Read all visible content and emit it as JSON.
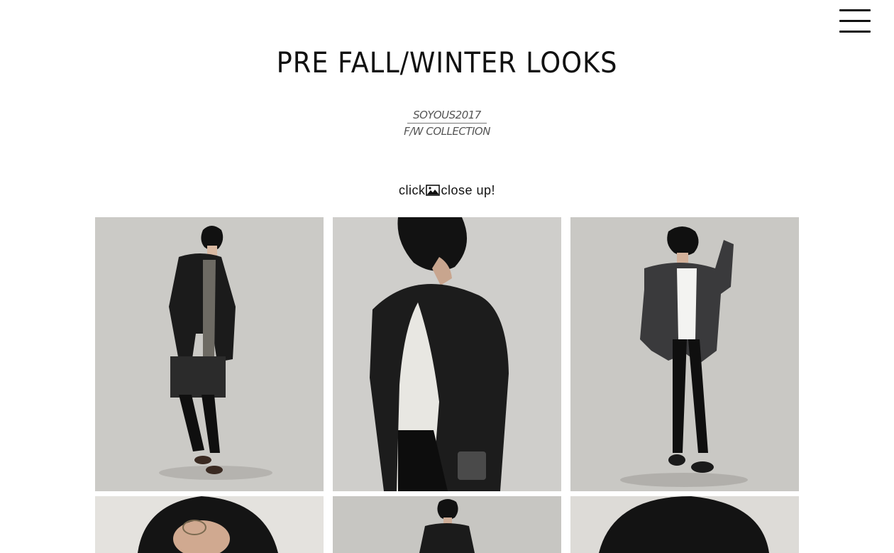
{
  "header": {
    "menu_icon": "hamburger-menu-icon",
    "title": "PRE FALL/WINTER LOOKS",
    "collection_line1": "SOYOUS2017",
    "collection_line2": "F/W COLLECTION"
  },
  "hint": {
    "before": "click",
    "icon": "picture-icon",
    "after": "close up!"
  },
  "gallery": {
    "background_color": "#c9c8c4",
    "looks": [
      {
        "name": "look-1",
        "description": "full-body, black jacket with clutch"
      },
      {
        "name": "look-2",
        "description": "close-up, black jacket over white tee"
      },
      {
        "name": "look-3",
        "description": "full-body, grey jacket, hand to glasses"
      },
      {
        "name": "look-4",
        "description": "head close-up with glasses"
      },
      {
        "name": "look-5",
        "description": "distant full-body"
      },
      {
        "name": "look-6",
        "description": "head close-up, hair"
      }
    ]
  }
}
